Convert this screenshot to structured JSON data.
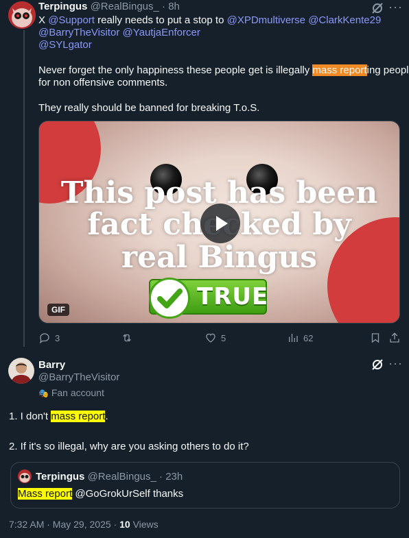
{
  "tweet1": {
    "author_name": "Terpingus",
    "author_handle": "@RealBingus_",
    "separator": "·",
    "time": "8h",
    "reply_prefix": "X",
    "mention_support": "@Support",
    "reply_mid": "really needs to put a stop to",
    "mention_xpd": "@XPDmultiverse",
    "mention_clark": "@ClarkKente29",
    "mention_barry": "@BarryTheVisitor",
    "mention_yautja": "@YautjaEnforcer",
    "mention_syl": "@SYLgator",
    "para2_before": "Never forget the only happiness these people get is illegally",
    "para2_highlight": "mass report",
    "para2_after": "ing people",
    "para2_line2": "for non offensive comments.",
    "para3": "They really should be banned for breaking T.o.S.",
    "media": {
      "line1": "This post has been",
      "line2": "fact checked by",
      "line3": "real Bingus",
      "badge": "TRUE",
      "gif_label": "GIF"
    },
    "actions": {
      "replies": "3",
      "reposts": "",
      "likes": "5",
      "views": "62"
    }
  },
  "tweet2": {
    "author_name": "Barry",
    "author_handle": "@BarryTheVisitor",
    "account_label": "Fan account",
    "line1_prefix": "1. I don't",
    "line1_highlight": "mass report",
    "line1_suffix": ".",
    "line2": "2. If it's so illegal, why are you asking others to do it?",
    "quote": {
      "author_name": "Terpingus",
      "author_handle": "@RealBingus_",
      "separator": "·",
      "time": "23h",
      "highlight": "Mass report",
      "rest": "@GoGrokUrSelf thanks"
    },
    "timestamp": "7:32 AM · May 29, 2025 ·",
    "views_count": "10",
    "views_label": "Views"
  },
  "colors": {
    "background": "#15202b",
    "text": "#f7f9f9",
    "muted": "#8b98a5",
    "mention": "#8b98f9",
    "highlight_orange": "#f08a24",
    "highlight_yellow": "#ffff00"
  }
}
